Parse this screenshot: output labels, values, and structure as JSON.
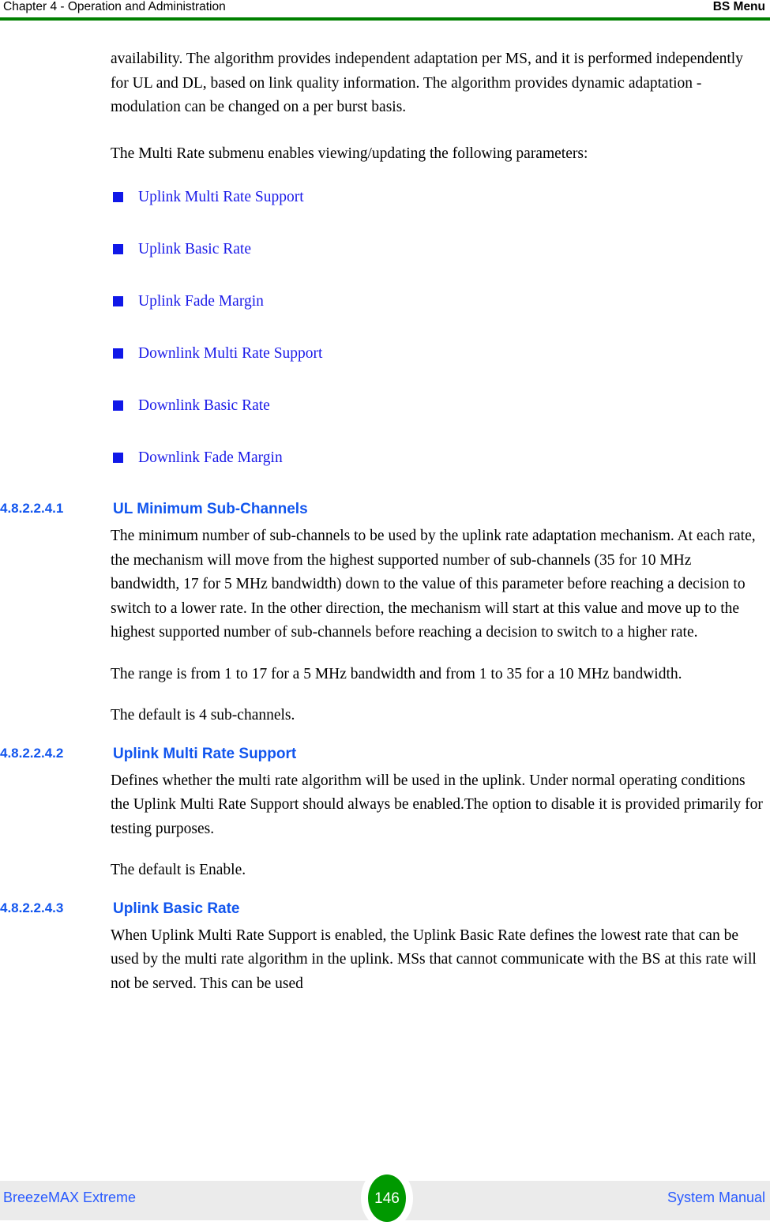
{
  "header": {
    "left": "Chapter 4 - Operation and Administration",
    "right": "BS Menu"
  },
  "colors": {
    "rule_green": "#008000",
    "heading_blue": "#1155ee",
    "bullet_blue": "#1018e8",
    "link_blue": "#1a1ae8",
    "footer_blue": "#2a5bff",
    "footer_band": "#ebebeb",
    "badge_green": "#009900"
  },
  "content": {
    "intro_paragraph": "availability. The algorithm provides independent adaptation per MS, and it is performed independently for UL and DL, based on link quality information. The algorithm provides dynamic adaptation - modulation can be changed on a per burst basis.",
    "submenu_paragraph": "The Multi Rate submenu enables viewing/updating the following parameters:",
    "parameter_links": [
      "Uplink Multi Rate Support",
      "Uplink Basic Rate",
      "Uplink Fade Margin",
      "Downlink Multi Rate Support",
      "Downlink Basic Rate",
      "Downlink Fade Margin"
    ],
    "sections": [
      {
        "number": "4.8.2.2.4.1",
        "title": "UL Minimum Sub-Channels",
        "paragraphs": [
          "The minimum number of sub-channels to be used by the uplink rate adaptation mechanism. At each rate, the mechanism will move from the highest supported number of sub-channels (35 for 10 MHz bandwidth, 17 for 5 MHz bandwidth) down to the value of this parameter before reaching a decision to switch to a lower rate. In the other direction, the mechanism will start at this value and move up to the highest supported number of sub-channels before reaching a decision to switch to a higher rate.",
          "The range is from 1 to 17 for a 5 MHz bandwidth and from 1 to 35 for a 10 MHz bandwidth.",
          "The default is 4 sub-channels."
        ]
      },
      {
        "number": "4.8.2.2.4.2",
        "title": "Uplink Multi Rate Support",
        "paragraphs": [
          "Defines whether the multi rate algorithm will be used in the uplink. Under normal operating conditions the Uplink Multi Rate Support should always be enabled.The option to disable it is provided primarily for testing purposes.",
          "The default is Enable."
        ]
      },
      {
        "number": "4.8.2.2.4.3",
        "title": "Uplink Basic Rate",
        "paragraphs": [
          "When Uplink Multi Rate Support is enabled, the Uplink Basic Rate defines the lowest rate that can be used by the multi rate algorithm in the uplink. MSs that cannot communicate with the BS at this rate will not be served. This can be used"
        ]
      }
    ]
  },
  "footer": {
    "left": "BreezeMAX Extreme",
    "page_number": "146",
    "right": "System Manual"
  }
}
